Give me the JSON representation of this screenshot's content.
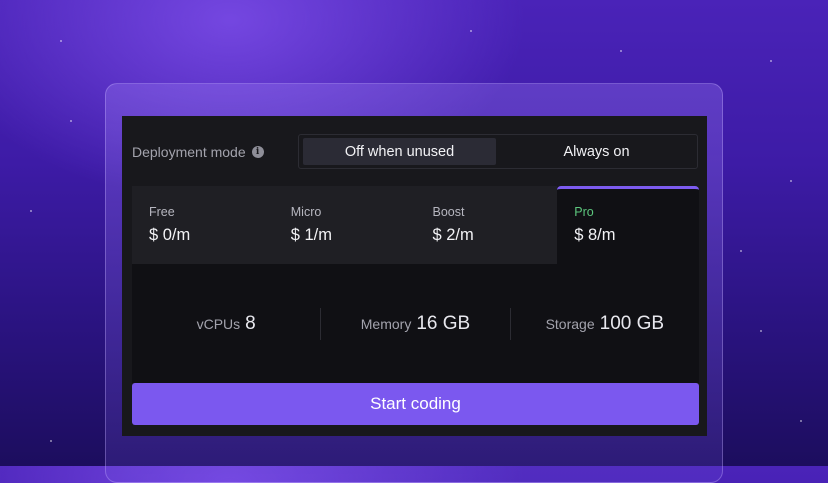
{
  "deployment": {
    "label": "Deployment mode",
    "info_icon": "info-icon",
    "options": [
      {
        "label": "Off when unused",
        "active": true
      },
      {
        "label": "Always on",
        "active": false
      }
    ]
  },
  "tiers": [
    {
      "name": "Free",
      "price": "$ 0/m",
      "selected": false
    },
    {
      "name": "Micro",
      "price": "$ 1/m",
      "selected": false
    },
    {
      "name": "Boost",
      "price": "$ 2/m",
      "selected": false
    },
    {
      "name": "Pro",
      "price": "$ 8/m",
      "selected": true
    }
  ],
  "specs": [
    {
      "label": "vCPUs",
      "value": "8"
    },
    {
      "label": "Memory",
      "value": "16 GB"
    },
    {
      "label": "Storage",
      "value": "100 GB"
    }
  ],
  "cta": {
    "label": "Start coding"
  },
  "colors": {
    "accent": "#7b58ef",
    "selected_tier_name": "#5dc77e",
    "panel_bg": "#18181c"
  }
}
